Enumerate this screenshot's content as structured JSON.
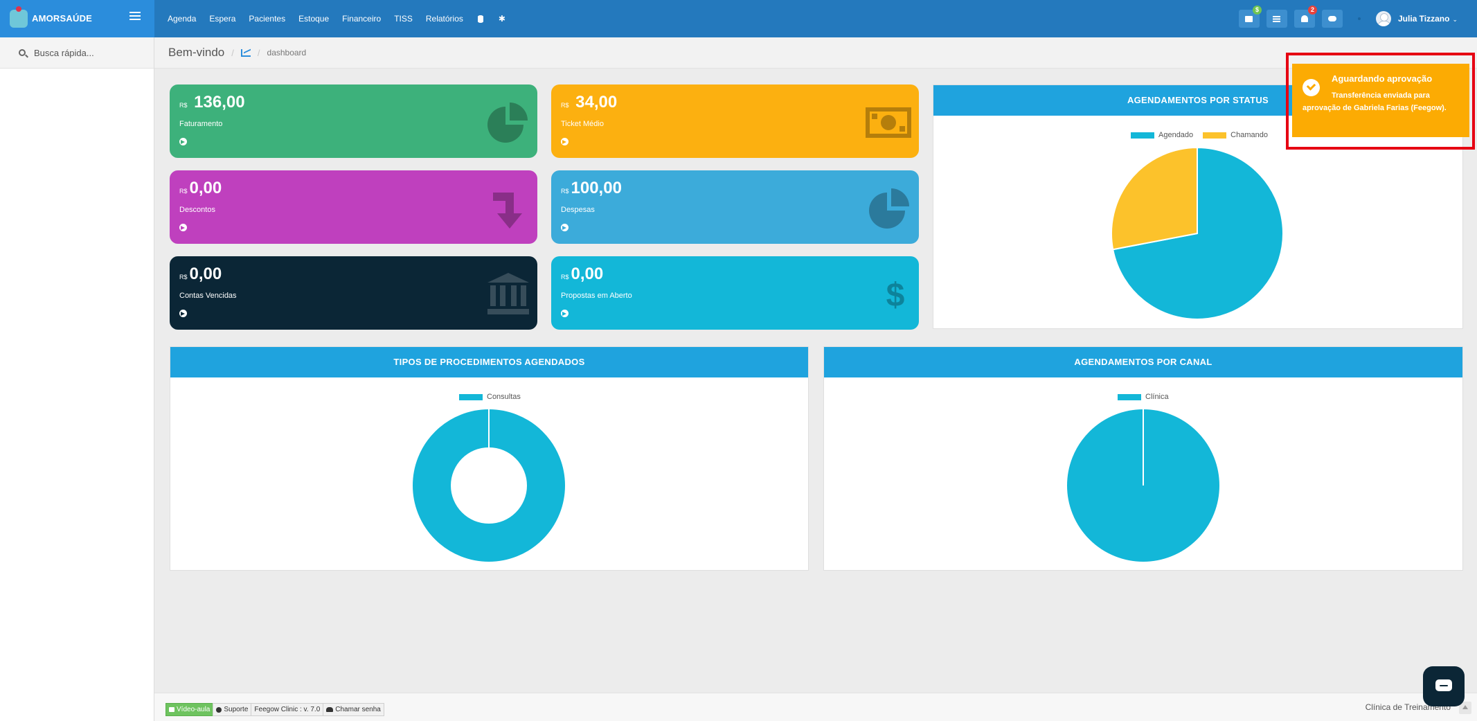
{
  "brand": {
    "name": "AMORSAÚDE",
    "tagline": ""
  },
  "nav": {
    "items": [
      "Agenda",
      "Espera",
      "Pacientes",
      "Estoque",
      "Financeiro",
      "TISS",
      "Relatórios"
    ],
    "icons": [
      "database-icon",
      "gear-icon"
    ]
  },
  "topbar": {
    "inbox_badge": "$",
    "notifications_badge": "2",
    "user_name": "Julia Tizzano"
  },
  "sidebar": {
    "search_placeholder": "Busca rápida..."
  },
  "breadcrumb": {
    "title": "Bem-vindo",
    "current": "dashboard"
  },
  "tiles": [
    {
      "currency": "R$",
      "amount": " 136,00",
      "label": "Faturamento",
      "color": "#3db17b",
      "icon": "pie-chart-icon"
    },
    {
      "currency": "R$",
      "amount": " 34,00",
      "label": "Ticket Médio",
      "color": "#fcb010",
      "icon": "money-icon"
    },
    {
      "currency": "R$",
      "amount": "0,00",
      "label": "Descontos",
      "color": "#bf40be",
      "icon": "arrow-down-icon"
    },
    {
      "currency": "R$",
      "amount": "100,00",
      "label": "Despesas",
      "color": "#3cabda",
      "icon": "pie-chart-icon"
    },
    {
      "currency": "R$",
      "amount": "0,00",
      "label": "Contas Vencidas",
      "color": "#0b2636",
      "icon": "bank-icon"
    },
    {
      "currency": "R$",
      "amount": "0,00",
      "label": "Propostas em Aberto",
      "color": "#13b7d8",
      "icon": "dollar-icon"
    }
  ],
  "panels": {
    "status": {
      "title": "AGENDAMENTOS POR STATUS"
    },
    "tipos": {
      "title": "TIPOS DE PROCEDIMENTOS AGENDADOS"
    },
    "canal": {
      "title": "AGENDAMENTOS POR CANAL"
    }
  },
  "chart_data": [
    {
      "type": "pie",
      "title": "AGENDAMENTOS POR STATUS",
      "legend_position": "top",
      "series": [
        {
          "name": "Agendado",
          "value": 72,
          "color": "#13b7d8"
        },
        {
          "name": "Chamando",
          "value": 28,
          "color": "#fcc22b"
        }
      ]
    },
    {
      "type": "pie",
      "subtype": "doughnut",
      "title": "TIPOS DE PROCEDIMENTOS AGENDADOS",
      "legend_position": "top",
      "series": [
        {
          "name": "Consultas",
          "value": 100,
          "color": "#13b7d8"
        }
      ]
    },
    {
      "type": "pie",
      "title": "AGENDAMENTOS POR CANAL",
      "legend_position": "top",
      "series": [
        {
          "name": "Clínica",
          "value": 100,
          "color": "#13b7d8"
        }
      ]
    }
  ],
  "toast": {
    "title": "Aguardando aprovação",
    "message": "Transferência enviada para aprovação de Gabriela Farias (Feegow).",
    "color": "#fcab03",
    "highlight_color": "#e60012"
  },
  "footer": {
    "video": "Vídeo-aula",
    "support": "Suporte",
    "version": "Feegow Clinic : v. 7.0",
    "call": "Chamar senha",
    "clinic": "Clínica de Treinamento"
  }
}
